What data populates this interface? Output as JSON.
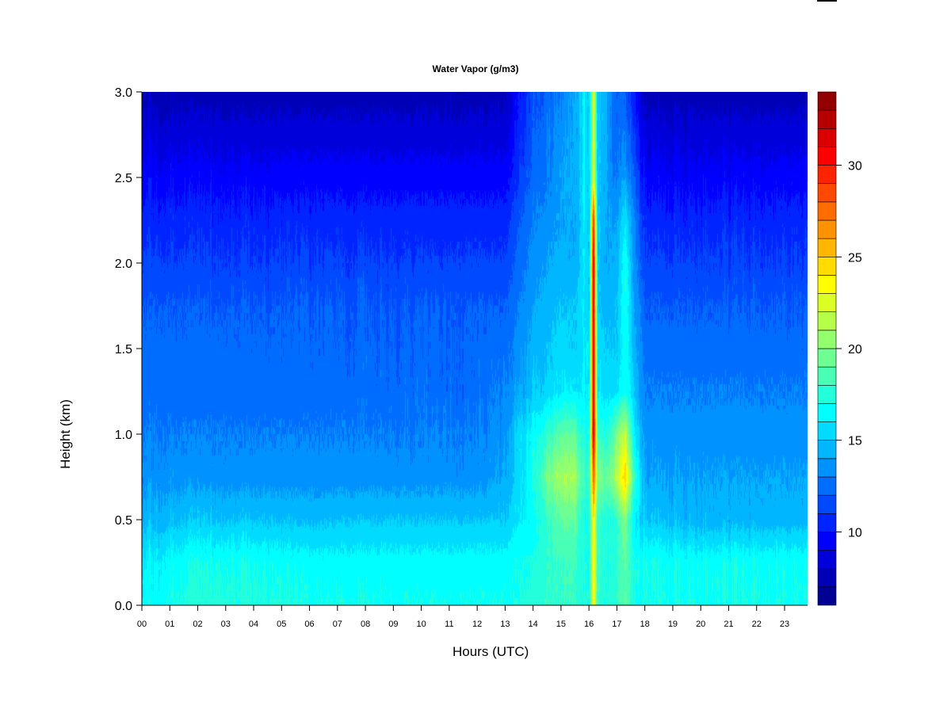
{
  "chart_data": {
    "type": "heatmap",
    "title": "Water Vapor (g/m3)",
    "xlabel": "Hours (UTC)",
    "ylabel": "Height (km)",
    "xlim": [
      0,
      23.8
    ],
    "ylim": [
      0,
      3.0
    ],
    "x_tick_labels": [
      "00",
      "01",
      "02",
      "03",
      "04",
      "05",
      "06",
      "07",
      "08",
      "09",
      "10",
      "11",
      "12",
      "13",
      "14",
      "15",
      "16",
      "17",
      "18",
      "19",
      "20",
      "21",
      "22",
      "23"
    ],
    "y_tick_labels": [
      "0.0",
      "0.5",
      "1.0",
      "1.5",
      "2.0",
      "2.5",
      "3.0"
    ],
    "colorbar": {
      "min": 6,
      "max": 34,
      "step": 1,
      "tick_labels": [
        "10",
        "15",
        "20",
        "25",
        "30"
      ]
    },
    "heights_km": [
      0,
      0.25,
      0.5,
      0.75,
      1.0,
      1.25,
      1.5,
      1.75,
      2.0,
      2.25,
      2.5,
      2.75,
      3.0
    ],
    "times_h": [
      0,
      2,
      4,
      6,
      8,
      10,
      12,
      13,
      13.5,
      14,
      14.5,
      15,
      15.5,
      15.8,
      16.0,
      16.15,
      16.3,
      16.6,
      17.0,
      17.3,
      17.6,
      18,
      20,
      22,
      23.8
    ],
    "values_by_time": [
      [
        16.5,
        16,
        14.5,
        13.5,
        13,
        12.5,
        12.3,
        12,
        11.2,
        10.5,
        9.5,
        8.5,
        7.5
      ],
      [
        17.5,
        17,
        15,
        13.5,
        13,
        12.5,
        12.3,
        12,
        11.2,
        10.5,
        9.5,
        8.5,
        7.5
      ],
      [
        17.5,
        17,
        15,
        13.5,
        13,
        12.5,
        12.3,
        12,
        11.2,
        10.5,
        9.5,
        8.5,
        7.5
      ],
      [
        17,
        16.5,
        14.8,
        13.5,
        13,
        12.5,
        12.3,
        12,
        11.2,
        10.5,
        9.5,
        8.5,
        7.5
      ],
      [
        17,
        16.5,
        15,
        13.5,
        13,
        12.5,
        12.3,
        12,
        11.2,
        10.5,
        9.5,
        8.5,
        7.5
      ],
      [
        17,
        16.5,
        15,
        13.5,
        13,
        12.5,
        12.3,
        12,
        11.2,
        10.5,
        9.5,
        8.5,
        7.5
      ],
      [
        17,
        16.5,
        15,
        13.5,
        13,
        12.5,
        12.3,
        12,
        11.2,
        10.5,
        9.5,
        8.5,
        7.5
      ],
      [
        17,
        16.5,
        15,
        14,
        13.5,
        13,
        12.5,
        12,
        11.2,
        10.5,
        9.5,
        8.5,
        7.5
      ],
      [
        17,
        17,
        16,
        15.5,
        15.5,
        14,
        13.5,
        13,
        12.5,
        12,
        11,
        10.5,
        10
      ],
      [
        17.5,
        17,
        16.5,
        17,
        16.5,
        15,
        14.5,
        14,
        13.5,
        13,
        12.5,
        12,
        11.5
      ],
      [
        18,
        18,
        18,
        20,
        18,
        15.5,
        15,
        14.5,
        14,
        13.5,
        13,
        13,
        12.5
      ],
      [
        18,
        18,
        19,
        21,
        19,
        16,
        15.5,
        15,
        14.5,
        14,
        14,
        13.5,
        13
      ],
      [
        18,
        18,
        19,
        21,
        19,
        16,
        15,
        15,
        14,
        14,
        14,
        14,
        14
      ],
      [
        17,
        17,
        17,
        18,
        17,
        16,
        16,
        16,
        16,
        16,
        16,
        16,
        16
      ],
      [
        17,
        17,
        17,
        18,
        17,
        16,
        16,
        15,
        15,
        15,
        15,
        15,
        15
      ],
      [
        24,
        24,
        24,
        28,
        32,
        32,
        32,
        32,
        32,
        30,
        23,
        23,
        23
      ],
      [
        18,
        18,
        18,
        20,
        18,
        16,
        16,
        15,
        15,
        15,
        15,
        15,
        15
      ],
      [
        17,
        17,
        17,
        19,
        17,
        15.5,
        15,
        14.5,
        14,
        14,
        14,
        14,
        14
      ],
      [
        18,
        18,
        18,
        22,
        20,
        16,
        15,
        15,
        14.5,
        14,
        13,
        12.5,
        12
      ],
      [
        19,
        19,
        20,
        25,
        22,
        17,
        17,
        17,
        17,
        16,
        14,
        13,
        12
      ],
      [
        17,
        17,
        16,
        18,
        16,
        15,
        14.5,
        14,
        13.5,
        13,
        12,
        11,
        10
      ],
      [
        17,
        17,
        15,
        14,
        13.5,
        13,
        12.5,
        12,
        11.2,
        10.5,
        9.5,
        8.5,
        7.5
      ],
      [
        17,
        16.8,
        14.5,
        14,
        13.5,
        13,
        12.5,
        12,
        11.2,
        10.5,
        9.5,
        8.5,
        7.5
      ],
      [
        17,
        16.8,
        14.5,
        14,
        13.5,
        13,
        12.5,
        12,
        11.2,
        10.5,
        9.5,
        8.5,
        7.5
      ],
      [
        17,
        16.8,
        14.5,
        14,
        13.5,
        13,
        12.5,
        12,
        11.2,
        10.5,
        9.5,
        8.5,
        7.5
      ]
    ]
  }
}
